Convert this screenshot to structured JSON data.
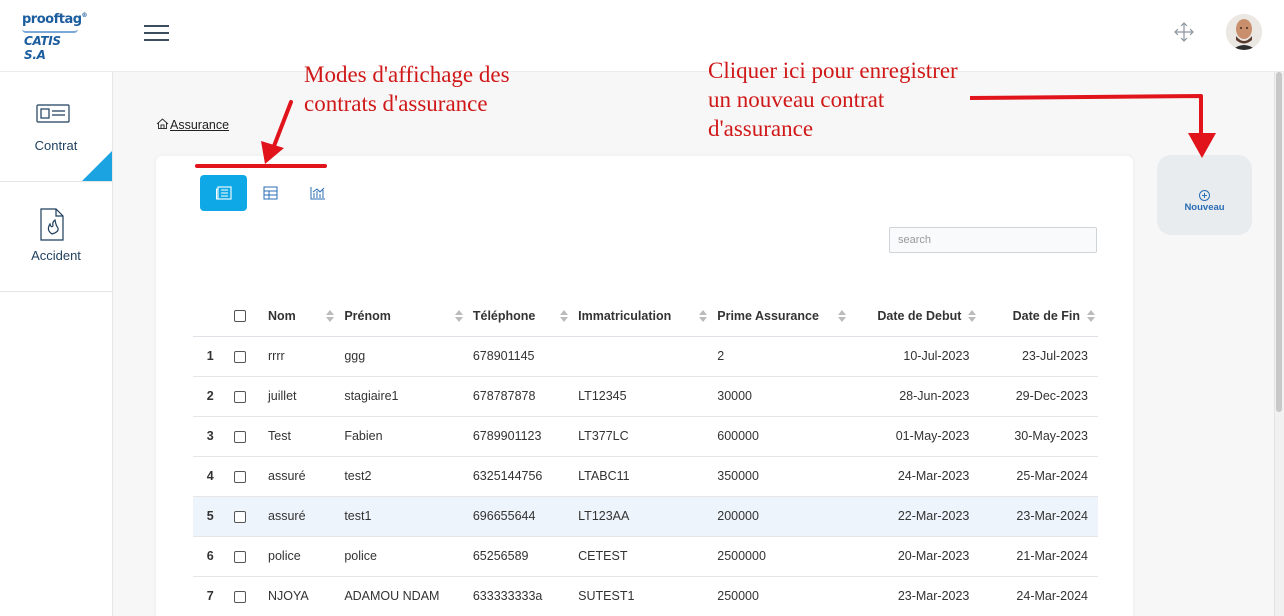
{
  "brand": {
    "line1": "prooftag",
    "tm": "®",
    "line2": "CATIS S.A"
  },
  "sidebar": {
    "items": [
      {
        "label": "Contrat"
      },
      {
        "label": "Accident"
      }
    ]
  },
  "annotations": {
    "modes_line1": "Modes d'affichage des",
    "modes_line2": "contrats d'assurance",
    "new_line1": "Cliquer ici pour enregistrer",
    "new_line2": "un nouveau contrat",
    "new_line3": "d'assurance"
  },
  "breadcrumb": {
    "label": "Assurance"
  },
  "nouveau": {
    "label": "Nouveau"
  },
  "search": {
    "placeholder": "search"
  },
  "table": {
    "headers": {
      "nom": "Nom",
      "prenom": "Prénom",
      "telephone": "Téléphone",
      "immatriculation": "Immatriculation",
      "prime": "Prime Assurance",
      "debut": "Date de Debut",
      "fin": "Date de Fin"
    },
    "rows": [
      {
        "num": "1",
        "nom": "rrrr",
        "prenom": "ggg",
        "telephone": "678901145",
        "immatriculation": "",
        "prime": "2",
        "debut": "10-Jul-2023",
        "fin": "23-Jul-2023"
      },
      {
        "num": "2",
        "nom": "juillet",
        "prenom": "stagiaire1",
        "telephone": "678787878",
        "immatriculation": "LT12345",
        "prime": "30000",
        "debut": "28-Jun-2023",
        "fin": "29-Dec-2023"
      },
      {
        "num": "3",
        "nom": "Test",
        "prenom": "Fabien",
        "telephone": "6789901123",
        "immatriculation": "LT377LC",
        "prime": "600000",
        "debut": "01-May-2023",
        "fin": "30-May-2023"
      },
      {
        "num": "4",
        "nom": "assuré",
        "prenom": "test2",
        "telephone": "6325144756",
        "immatriculation": "LTABC11",
        "prime": "350000",
        "debut": "24-Mar-2023",
        "fin": "25-Mar-2024"
      },
      {
        "num": "5",
        "nom": "assuré",
        "prenom": "test1",
        "telephone": "696655644",
        "immatriculation": "LT123AA",
        "prime": "200000",
        "debut": "22-Mar-2023",
        "fin": "23-Mar-2024"
      },
      {
        "num": "6",
        "nom": "police",
        "prenom": "police",
        "telephone": "65256589",
        "immatriculation": "CETEST",
        "prime": "2500000",
        "debut": "20-Mar-2023",
        "fin": "21-Mar-2024"
      },
      {
        "num": "7",
        "nom": "NJOYA",
        "prenom": "ADAMOU NDAM",
        "telephone": "633333333a",
        "immatriculation": "SUTEST1",
        "prime": "250000",
        "debut": "23-Mar-2023",
        "fin": "24-Mar-2024"
      }
    ]
  },
  "colors": {
    "accent": "#0fa8e6",
    "annotation": "#d01818",
    "brand": "#1c5d9e"
  },
  "icons": {
    "view_modes": [
      "card-view-icon",
      "table-view-icon",
      "chart-view-icon"
    ],
    "header": [
      "menu-icon",
      "fullscreen-icon"
    ]
  }
}
